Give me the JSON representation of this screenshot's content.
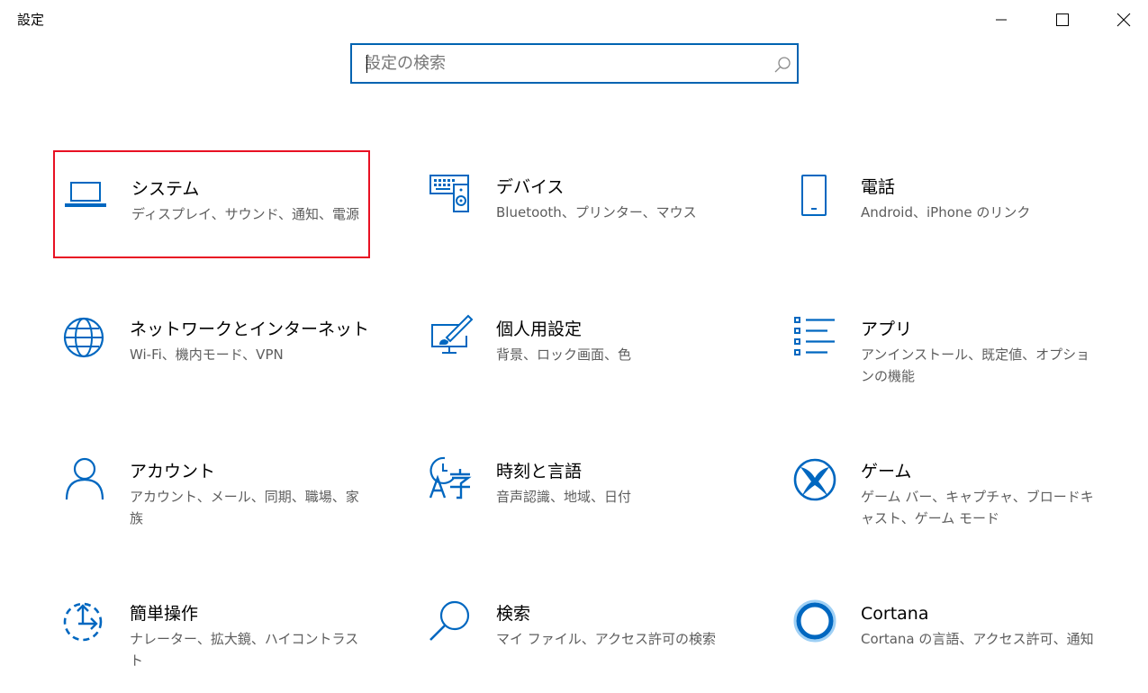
{
  "window": {
    "title": "設定",
    "minimize_icon": "minimize-icon",
    "maximize_icon": "maximize-icon",
    "close_icon": "close-icon"
  },
  "search": {
    "placeholder": "設定の検索",
    "value": "",
    "icon": "search-icon"
  },
  "colors": {
    "accent": "#0063b1",
    "icon": "#0067c0",
    "selection_border": "#e81123",
    "description": "#5d5d5d"
  },
  "categories": [
    {
      "name": "システム",
      "description": "ディスプレイ、サウンド、通知、電源",
      "icon": "laptop-icon",
      "selected": true
    },
    {
      "name": "デバイス",
      "description": "Bluetooth、プリンター、マウス",
      "icon": "keyboard-speaker-icon"
    },
    {
      "name": "電話",
      "description": "Android、iPhone のリンク",
      "icon": "phone-icon"
    },
    {
      "name": "ネットワークとインターネット",
      "description": "Wi-Fi、機内モード、VPN",
      "icon": "globe-icon"
    },
    {
      "name": "個人用設定",
      "description": "背景、ロック画面、色",
      "icon": "paintbrush-monitor-icon"
    },
    {
      "name": "アプリ",
      "description": "アンインストール、既定値、オプションの機能",
      "icon": "app-list-icon"
    },
    {
      "name": "アカウント",
      "description": "アカウント、メール、同期、職場、家族",
      "icon": "person-icon"
    },
    {
      "name": "時刻と言語",
      "description": "音声認識、地域、日付",
      "icon": "time-language-icon"
    },
    {
      "name": "ゲーム",
      "description": "ゲーム バー、キャプチャ、ブロードキャスト、ゲーム モード",
      "icon": "xbox-icon"
    },
    {
      "name": "簡単操作",
      "description": "ナレーター、拡大鏡、ハイコントラスト",
      "icon": "ease-of-access-icon"
    },
    {
      "name": "検索",
      "description": "マイ ファイル、アクセス許可の検索",
      "icon": "magnifier-icon"
    },
    {
      "name": "Cortana",
      "description": "Cortana の言語、アクセス許可、通知",
      "icon": "cortana-icon"
    }
  ]
}
